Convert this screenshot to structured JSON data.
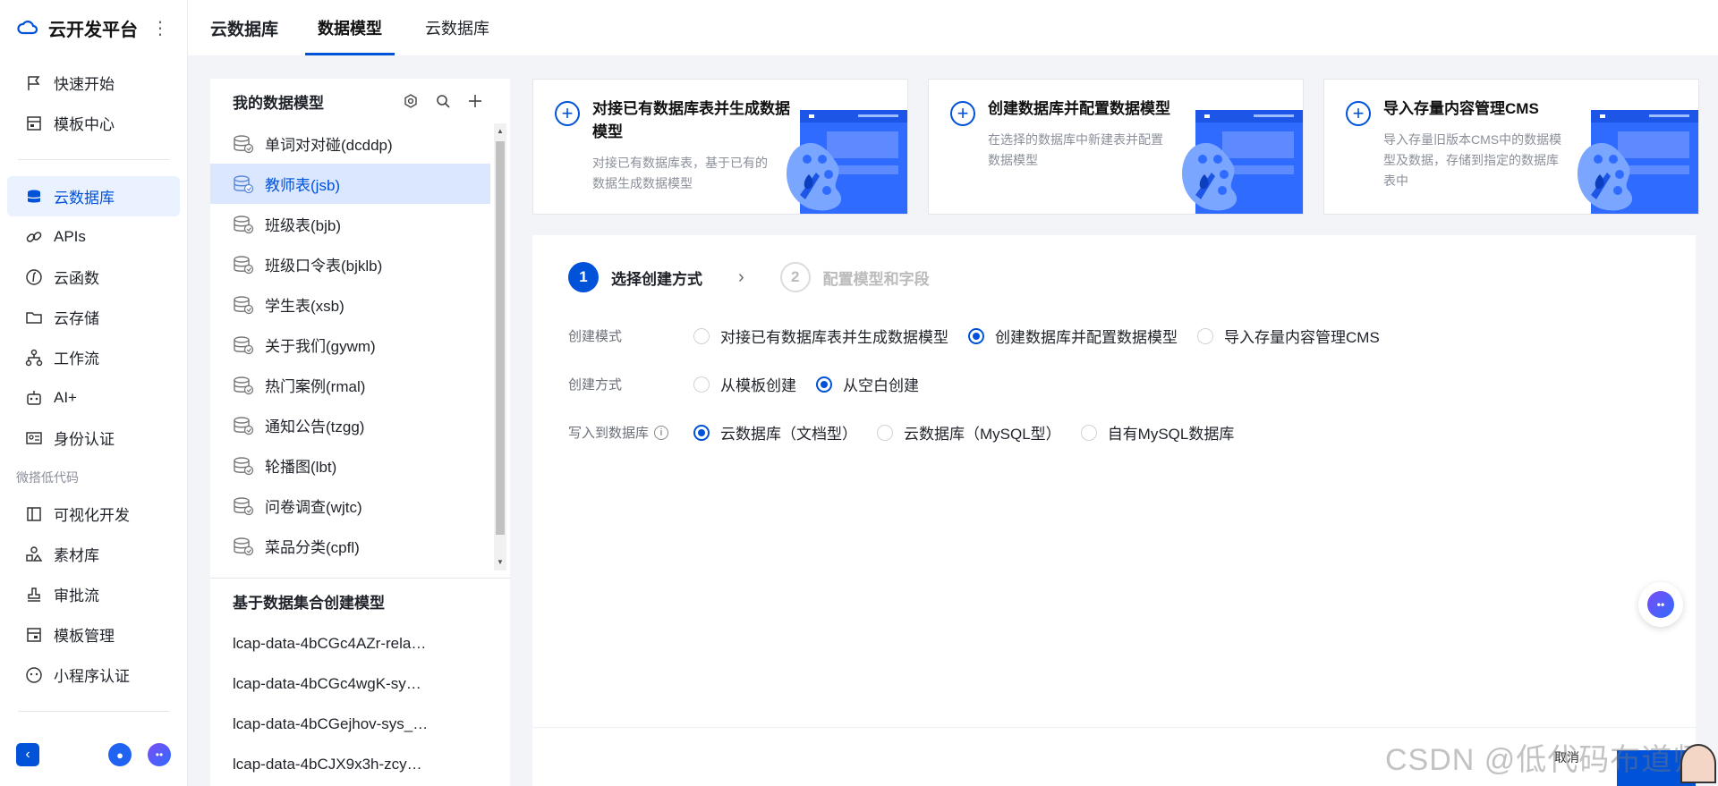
{
  "brand": {
    "title": "云开发平台",
    "more": "⋮"
  },
  "sidebar": {
    "items_top": [
      {
        "label": "快速开始",
        "icon": "flag-icon"
      },
      {
        "label": "模板中心",
        "icon": "template-icon"
      }
    ],
    "items_main": [
      {
        "label": "云数据库",
        "icon": "database-icon",
        "active": true
      },
      {
        "label": "APIs",
        "icon": "link-icon"
      },
      {
        "label": "云函数",
        "icon": "function-icon"
      },
      {
        "label": "云存储",
        "icon": "folder-icon"
      },
      {
        "label": "工作流",
        "icon": "workflow-icon"
      },
      {
        "label": "AI+",
        "icon": "robot-icon"
      },
      {
        "label": "身份认证",
        "icon": "id-card-icon"
      }
    ],
    "section_label": "微搭低代码",
    "items_lowcode": [
      {
        "label": "可视化开发",
        "icon": "layout-icon"
      },
      {
        "label": "素材库",
        "icon": "shapes-icon"
      },
      {
        "label": "审批流",
        "icon": "stamp-icon"
      },
      {
        "label": "模板管理",
        "icon": "template-manage-icon"
      },
      {
        "label": "小程序认证",
        "icon": "miniapp-icon"
      }
    ]
  },
  "topbar": {
    "crumb": "云数据库",
    "tabs": [
      {
        "label": "数据模型",
        "active": true
      },
      {
        "label": "云数据库",
        "active": false
      }
    ]
  },
  "models": {
    "header": "我的数据模型",
    "items": [
      "单词对对碰(dcddp)",
      "教师表(jsb)",
      "班级表(bjb)",
      "班级口令表(bjklb)",
      "学生表(xsb)",
      "关于我们(gywm)",
      "热门案例(rmal)",
      "通知公告(tzgg)",
      "轮播图(lbt)",
      "问卷调查(wjtc)",
      "菜品分类(cpfl)"
    ],
    "active_index": 1,
    "section2_header": "基于数据集合创建模型",
    "lcap_items": [
      "lcap-data-4bCGc4AZr-rela…",
      "lcap-data-4bCGc4wgK-sy…",
      "lcap-data-4bCGejhov-sys_…",
      "lcap-data-4bCJX9x3h-zcy…"
    ]
  },
  "cards": [
    {
      "title": "对接已有数据库表并生成数据模型",
      "desc": "对接已有数据库表，基于已有的数据生成数据模型"
    },
    {
      "title": "创建数据库并配置数据模型",
      "desc": "在选择的数据库中新建表并配置数据模型"
    },
    {
      "title": "导入存量内容管理CMS",
      "desc": "导入存量旧版本CMS中的数据模型及数据，存储到指定的数据库表中"
    }
  ],
  "steps": [
    {
      "num": "1",
      "label": "选择创建方式"
    },
    {
      "num": "2",
      "label": "配置模型和字段"
    }
  ],
  "form": {
    "mode_label": "创建模式",
    "mode_options": [
      "对接已有数据库表并生成数据模型",
      "创建数据库并配置数据模型",
      "导入存量内容管理CMS"
    ],
    "mode_selected": 1,
    "method_label": "创建方式",
    "method_options": [
      "从模板创建",
      "从空白创建"
    ],
    "method_selected": 1,
    "db_label": "写入到数据库",
    "db_options": [
      "云数据库（文档型）",
      "云数据库（MySQL型）",
      "自有MySQL数据库"
    ],
    "db_selected": 0
  },
  "footer": {
    "cancel": "取消"
  },
  "watermark": "CSDN @低代码布道师",
  "colors": {
    "accent": "#0052d9",
    "active_bg": "#dbe7ff"
  }
}
